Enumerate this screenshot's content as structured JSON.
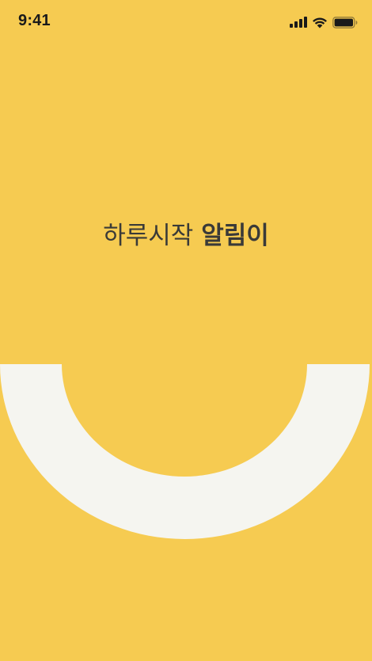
{
  "status_bar": {
    "time": "9:41",
    "icons": [
      "cellular-signal-icon",
      "wifi-icon",
      "battery-icon"
    ]
  },
  "title": {
    "light": "하루시작 ",
    "bold": "알림이"
  },
  "colors": {
    "background": "#F6CB51",
    "arc": "#F5F5F0",
    "text": "#3a3a38"
  },
  "decoration": "smile-arc"
}
